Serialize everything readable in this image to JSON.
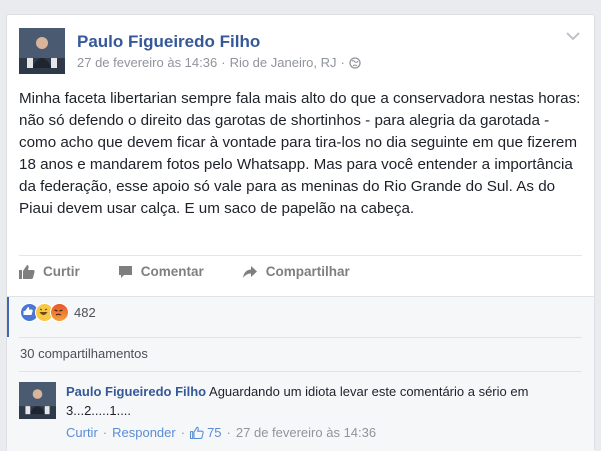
{
  "post": {
    "author": "Paulo Figueiredo Filho",
    "date": "27 de fevereiro às 14:36",
    "separator": "·",
    "location": "Rio de Janeiro, RJ",
    "privacy_icon": "globe-icon",
    "text": "Minha faceta libertarian sempre fala mais alto do que a conservadora nestas horas: não só defendo o direito das garotas de shortinhos - para alegria da garotada - como acho que devem ficar à vontade para tira-los no dia seguinte em que fizerem 18 anos e mandarem fotos pelo Whatsapp. Mas para você entender a importância da federação, esse apoio só vale para as meninas do Rio Grande do Sul. As do Piaui devem usar calça. E um saco de papelão na cabeça."
  },
  "actions": {
    "like": "Curtir",
    "comment": "Comentar",
    "share": "Compartilhar"
  },
  "reactions": {
    "types": [
      "like",
      "haha",
      "angry"
    ],
    "count": "482"
  },
  "shares": "30 compartilhamentos",
  "comment": {
    "author": "Paulo Figueiredo Filho",
    "text": "Aguardando um idiota levar este comentário a sério em 3...2.....1....",
    "like": "Curtir",
    "reply": "Responder",
    "dot": "·",
    "likes": "75",
    "date": "27 de fevereiro às 14:36"
  },
  "colors": {
    "link_blue": "#365899",
    "facebook_blue": "#4267b2",
    "muted": "#90949c"
  }
}
